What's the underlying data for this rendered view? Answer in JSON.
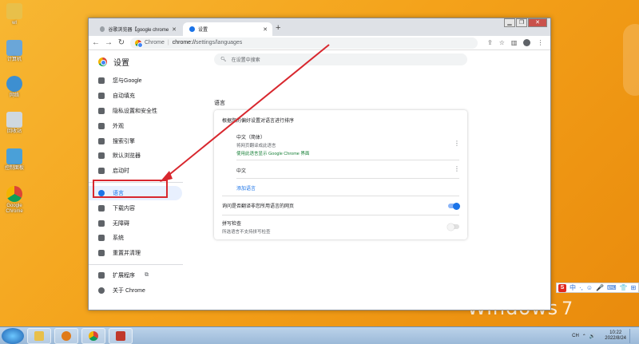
{
  "desktop": {
    "icons": [
      {
        "label": "wl"
      },
      {
        "label": "计算机"
      },
      {
        "label": "网络"
      },
      {
        "label": "回收站"
      },
      {
        "label": "控制面板"
      },
      {
        "label": "Google Chrome"
      }
    ],
    "watermark": "Windows",
    "watermark_version": "7"
  },
  "ime_bar": {
    "logo": "S",
    "items": [
      "中",
      "·,",
      "☺",
      "🎤",
      "⌨",
      "👕",
      "⊞"
    ]
  },
  "browser": {
    "tabs": [
      {
        "label": "谷歌浏览器【google chrome】",
        "active": false
      },
      {
        "label": "设置",
        "active": true
      }
    ],
    "new_tab": "+",
    "window_controls": [
      "▁",
      "❐",
      "✕"
    ],
    "address": {
      "site": "Chrome",
      "divider": "|",
      "host": "chrome://",
      "path": "settings/languages"
    }
  },
  "settings": {
    "title": "设置",
    "search_placeholder": "在设置中搜索",
    "nav": [
      {
        "label": "您与Google",
        "icon": "person-icon"
      },
      {
        "label": "自动填充",
        "icon": "autofill-icon"
      },
      {
        "label": "隐私设置和安全性",
        "icon": "shield-icon"
      },
      {
        "label": "外观",
        "icon": "palette-icon"
      },
      {
        "label": "搜索引擎",
        "icon": "search-icon"
      },
      {
        "label": "默认浏览器",
        "icon": "browser-icon"
      },
      {
        "label": "启动时",
        "icon": "power-icon"
      },
      {
        "label": "语言",
        "icon": "globe-icon",
        "active": true
      },
      {
        "label": "下载内容",
        "icon": "download-icon"
      },
      {
        "label": "无障碍",
        "icon": "accessibility-icon"
      },
      {
        "label": "系统",
        "icon": "wrench-icon"
      },
      {
        "label": "重置并清理",
        "icon": "reset-icon"
      }
    ],
    "nav_footer": [
      {
        "label": "扩展程序",
        "icon": "puzzle-icon"
      },
      {
        "label": "关于 Chrome",
        "icon": "chrome-icon"
      }
    ],
    "section_title": "语言",
    "card_header": "根据您的偏好设置对语言进行排序",
    "languages": [
      {
        "name": "中文（简体）",
        "sub1": "将网页翻译成此语言",
        "sub2": "使用此语言显示 Google Chrome 界面"
      },
      {
        "name": "中文"
      }
    ],
    "add_language": "添加语言",
    "offer_translate": {
      "label": "询问是否翻译非您所用语言的网页",
      "enabled": true
    },
    "spell_check": {
      "label": "拼写检查",
      "sub": "所选语言不支持拼写检查",
      "enabled": false
    }
  },
  "taskbar": {
    "tray_items": [
      "CH",
      "⌃",
      "🔊"
    ],
    "time": "10:22",
    "date": "2022/8/24"
  }
}
